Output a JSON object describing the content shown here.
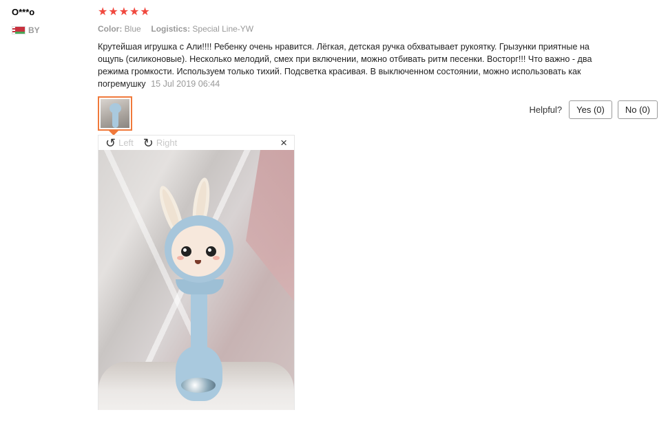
{
  "review": {
    "user_name": "O***o",
    "country_code": "BY",
    "rating": 5,
    "stars": [
      "★",
      "★",
      "★",
      "★",
      "★"
    ],
    "color_label": "Color:",
    "color_value": "Blue",
    "logistics_label": "Logistics:",
    "logistics_value": "Special Line-YW",
    "text": "Крутейшая игрушка с Али!!!! Ребенку очень нравится. Лёгкая, детская ручка обхватывает рукоятку. Грызунки приятные на ощупь (силиконовые). Несколько мелодий, смех при включении, можно отбивать ритм песенки. Восторг!!! Что важно - два режима громкости. Используем только тихий. Подсветка красивая. В выключенном состоянии, можно использовать как погремушку",
    "date": "15 Jul 2019 06:44"
  },
  "helpful": {
    "label": "Helpful?",
    "yes_label": "Yes (0)",
    "no_label": "No (0)"
  },
  "viewer": {
    "rotate_left_label": "Left",
    "rotate_right_label": "Right",
    "close_glyph": "×"
  },
  "colors": {
    "star": "#f0483e",
    "thumb_border": "#f0793b",
    "muted_text": "#999999"
  },
  "icons": {
    "rotate_left": "rotate-left-icon",
    "rotate_right": "rotate-right-icon",
    "close": "close-icon",
    "flag": "belarus-flag-icon"
  }
}
